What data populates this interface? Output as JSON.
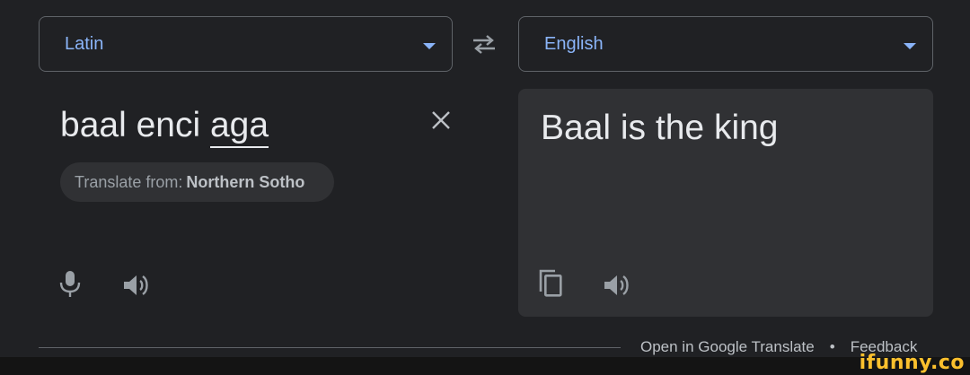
{
  "source_language": {
    "label": "Latin"
  },
  "target_language": {
    "label": "English"
  },
  "source_input": {
    "part1": "baal enci ",
    "part2": "aga"
  },
  "detect_chip": {
    "prefix": "Translate from:",
    "language": "Northern Sotho"
  },
  "translation": {
    "text": "Baal is the king"
  },
  "footer": {
    "open_link": "Open in Google Translate",
    "separator": "•",
    "feedback": "Feedback"
  },
  "watermark": {
    "text": "ifunny.co"
  },
  "colors": {
    "accent": "#8ab4f8",
    "background": "#202124",
    "panel": "#303134",
    "text": "#e8eaed",
    "muted": "#9aa0a6"
  },
  "icons": [
    "chevron-down-icon",
    "swap-icon",
    "close-icon",
    "microphone-icon",
    "speaker-icon",
    "copy-icon"
  ]
}
